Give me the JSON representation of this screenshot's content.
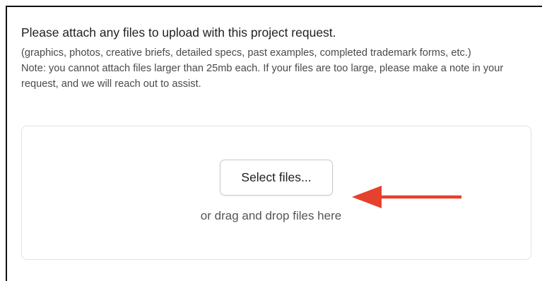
{
  "upload": {
    "title": "Please attach any files to upload with this project request.",
    "file_types_hint": "(graphics, photos, creative briefs, detailed specs, past examples, completed trademark forms, etc.)",
    "size_note": "Note: you cannot attach files larger than 25mb each. If your files are too large, please make a note in your request, and we will reach out to assist.",
    "select_button_label": "Select files...",
    "drop_hint": "or drag and drop files here"
  },
  "annotation": {
    "arrow_color": "#e5412c",
    "arrow_icon": "arrow-left-icon"
  },
  "colors": {
    "frame_border": "#111111",
    "dropzone_border": "#e2e2e2",
    "text_primary": "#1f1f1f",
    "text_secondary": "#4a4a4a"
  }
}
